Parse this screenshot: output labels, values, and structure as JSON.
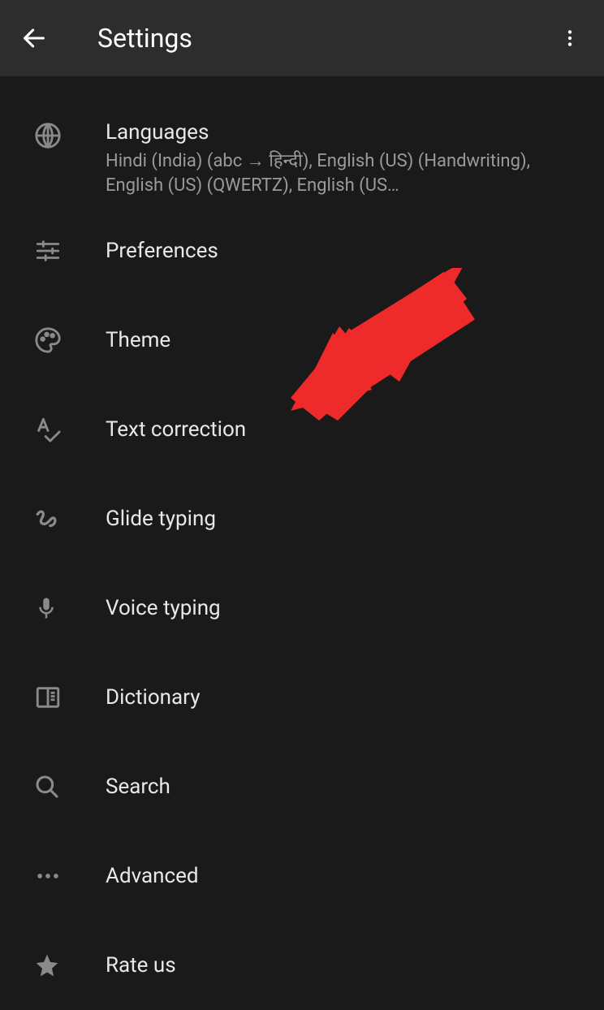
{
  "header": {
    "title": "Settings"
  },
  "items": [
    {
      "title": "Languages",
      "subtitle": "Hindi (India) (abc → हिन्दी), English (US) (Handwriting), English (US) (QWERTZ), English (US…"
    },
    {
      "title": "Preferences"
    },
    {
      "title": "Theme"
    },
    {
      "title": "Text correction"
    },
    {
      "title": "Glide typing"
    },
    {
      "title": "Voice typing"
    },
    {
      "title": "Dictionary"
    },
    {
      "title": "Search"
    },
    {
      "title": "Advanced"
    },
    {
      "title": "Rate us"
    }
  ],
  "annotation": {
    "arrow_points_to": "Text correction",
    "color": "#ef2a2a"
  }
}
